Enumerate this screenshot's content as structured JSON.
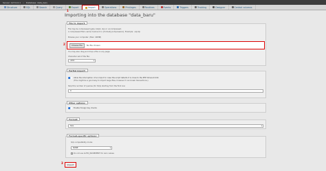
{
  "breadcrumb": {
    "server": "Server: 127.0.0.1",
    "separator": "»",
    "database": "Database: data_baru"
  },
  "tabs": [
    {
      "label": "Structure",
      "icon": "table-icon",
      "color": "#6a8fbd"
    },
    {
      "label": "SQL",
      "icon": "sql-icon",
      "color": "#777777"
    },
    {
      "label": "Search",
      "icon": "search-icon",
      "color": "#888888"
    },
    {
      "label": "Query",
      "icon": "query-icon",
      "color": "#999999"
    },
    {
      "label": "Export",
      "icon": "export-icon",
      "color": "#5a8a3a"
    },
    {
      "label": "Import",
      "icon": "import-icon",
      "color": "#c9a227",
      "active": true
    },
    {
      "label": "Operations",
      "icon": "wrench-icon",
      "color": "#777777"
    },
    {
      "label": "Privileges",
      "icon": "privileges-icon",
      "color": "#9b6a2a"
    },
    {
      "label": "Routines",
      "icon": "routines-icon",
      "color": "#7a7a7a"
    },
    {
      "label": "Events",
      "icon": "clock-icon",
      "color": "#b33"
    },
    {
      "label": "Triggers",
      "icon": "triggers-icon",
      "color": "#2b6cb0"
    },
    {
      "label": "Tracking",
      "icon": "eye-icon",
      "color": "#666666"
    },
    {
      "label": "Designer",
      "icon": "designer-icon",
      "color": "#555555"
    },
    {
      "label": "Central columns",
      "icon": "columns-icon",
      "color": "#666666"
    }
  ],
  "markers": {
    "one": "1",
    "two": "2",
    "three": "3"
  },
  "title": "Importing into the database \"data_baru\"",
  "file_section": {
    "legend": "File to import:",
    "line1": "File may be compressed (gzip, bzip2, zip) or uncompressed.",
    "line2": "A compressed file's name must end in .[format].[compression]. Example: .sql.zip",
    "line3": "Browse your computer: (Max: 40MiB)",
    "choose_file": "Choose File",
    "no_file": "No file chosen",
    "line4": "You may also drag and drop a file on any page.",
    "charset_label": "Character set of the file:",
    "charset_value": "utf-8"
  },
  "partial_section": {
    "legend": "Partial import:",
    "toggle_label": "Allow the interruption of an import in case the script detects it is close to the PHP timeout limit.",
    "toggle_sub": "(This might be a good way to import large files, however it can break transactions.)",
    "skip_label": "Skip this number of queries (for SQL) starting from the first one:",
    "skip_value": "0"
  },
  "other_section": {
    "legend": "Other options:",
    "toggle_label": "Enable foreign key checks"
  },
  "format_section": {
    "legend": "Format:",
    "value": "SQL"
  },
  "format_specific": {
    "legend": "Format-specific options:",
    "compat_label": "SQL compatibility mode:",
    "compat_value": "NONE",
    "auto_increment_label": "Do not use AUTO_INCREMENT for zero values"
  },
  "import_button": "Import"
}
